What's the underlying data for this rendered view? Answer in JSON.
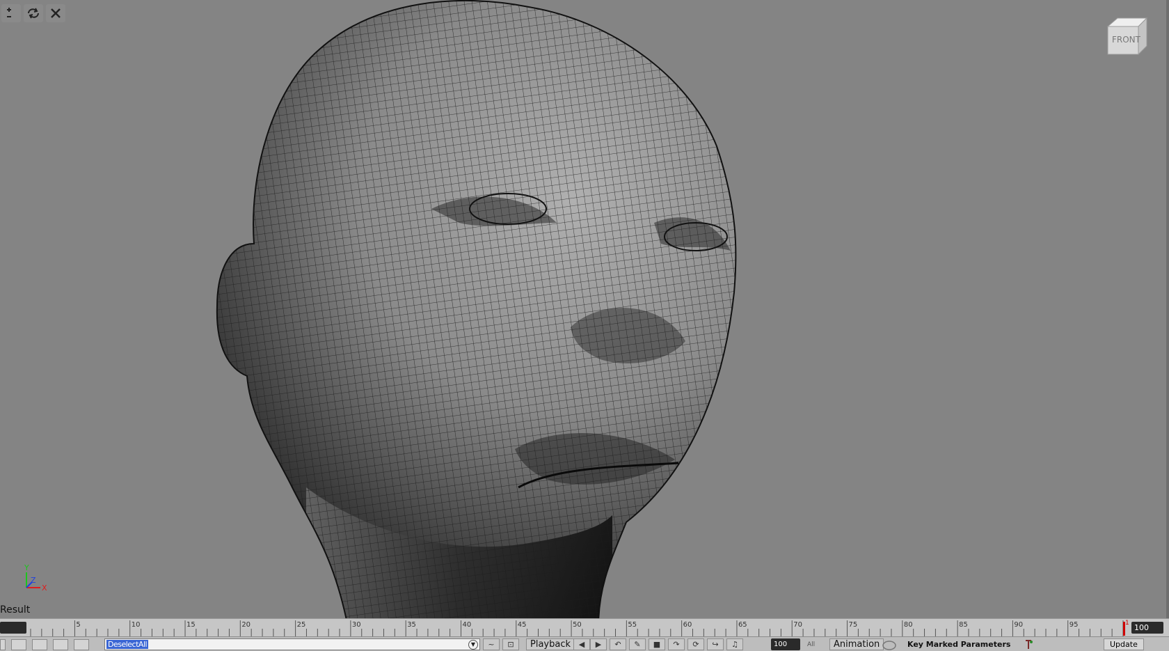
{
  "viewport": {
    "view_label": "FRONT",
    "result_label": "Result",
    "axis": {
      "y": "Y",
      "z": "Z",
      "x": "X"
    },
    "toolbar_icons": [
      "zoom-plus-minus-icon",
      "refresh-icon",
      "close-icon"
    ]
  },
  "timeline": {
    "ticks": [
      "5",
      "10",
      "15",
      "20",
      "25",
      "30",
      "35",
      "40",
      "45",
      "50",
      "55",
      "60",
      "65",
      "70",
      "75",
      "80",
      "85",
      "90",
      "95"
    ],
    "current_frame_marker": "1",
    "end_frame": "100"
  },
  "statusbar": {
    "command_value": "DeselectAll",
    "playback_label": "Playback",
    "speed_value": "100",
    "speed_unit": "All",
    "animation_label": "Animation",
    "key_marked_label": "Key Marked Parameters",
    "update_label": "Update"
  },
  "colors": {
    "viewport_bg": "#848484",
    "selection": "#3a66d4",
    "frame_marker": "#d00000"
  }
}
